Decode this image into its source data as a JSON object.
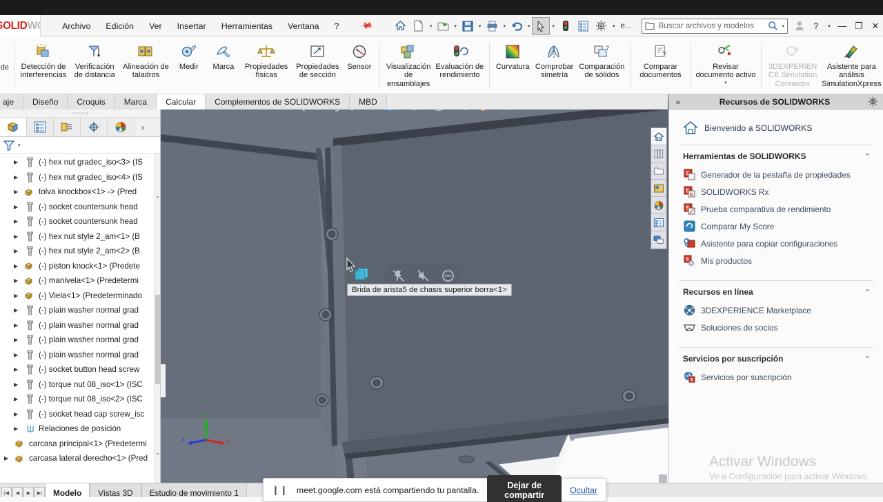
{
  "app": {
    "brand_solid": "SOLID",
    "brand_works": "WORKS"
  },
  "menubar": {
    "items": [
      {
        "label": "Archivo"
      },
      {
        "label": "Edición"
      },
      {
        "label": "Ver"
      },
      {
        "label": "Insertar"
      },
      {
        "label": "Herramientas"
      },
      {
        "label": "Ventana"
      },
      {
        "label": "?"
      }
    ],
    "pin_icon": "pin-icon"
  },
  "quick_access": {
    "buttons": [
      {
        "name": "home-icon",
        "caret": false
      },
      {
        "name": "new-document-icon",
        "caret": true
      },
      {
        "name": "open-folder-icon",
        "caret": true
      },
      {
        "name": "save-icon",
        "caret": true
      },
      {
        "name": "print-icon",
        "caret": true
      },
      {
        "name": "undo-icon",
        "caret": true
      },
      {
        "name": "select-arrow-icon",
        "caret": true
      },
      {
        "name": "rebuild-traffic-light-icon",
        "caret": false
      },
      {
        "name": "display-list-icon",
        "caret": false
      },
      {
        "name": "options-gear-icon",
        "caret": true
      }
    ],
    "overflow_label": "e..."
  },
  "search": {
    "placeholder": "Buscar archivos y modelos",
    "value": ""
  },
  "window_controls": {
    "account": "user-icon",
    "help": "?",
    "help_caret": "▾",
    "minimize": "—",
    "restore": "❐",
    "close": "✕"
  },
  "ribbon": {
    "left_stub": "de",
    "buttons": [
      {
        "label": "Detección de interferencias",
        "icon": "interference-detection-icon",
        "dim": false,
        "caret": false
      },
      {
        "label": "Verificación de distancia",
        "icon": "clearance-verification-icon",
        "dim": false,
        "caret": false
      },
      {
        "label": "Alineación de taladros",
        "icon": "hole-alignment-icon",
        "dim": false,
        "caret": false
      },
      {
        "label": "Medir",
        "icon": "measure-icon",
        "dim": false,
        "caret": false
      },
      {
        "label": "Marca",
        "icon": "markup-pen-icon",
        "dim": false,
        "caret": false
      },
      {
        "label": "Propiedades físicas",
        "icon": "mass-properties-icon",
        "dim": false,
        "caret": false
      },
      {
        "label": "Propiedades de sección",
        "icon": "section-properties-icon",
        "dim": false,
        "caret": false
      },
      {
        "label": "Sensor",
        "icon": "sensor-gauge-icon",
        "dim": false,
        "caret": false
      },
      {
        "label": "Visualización de ensamblajes",
        "icon": "assembly-visualization-icon",
        "dim": false,
        "caret": false
      },
      {
        "label": "Evaluación de rendimiento",
        "icon": "performance-evaluation-icon",
        "dim": false,
        "caret": false
      },
      {
        "label": "Curvatura",
        "icon": "curvature-icon",
        "dim": false,
        "caret": false
      },
      {
        "label": "Comprobar simetría",
        "icon": "symmetry-check-icon",
        "dim": false,
        "caret": false
      },
      {
        "label": "Comparación de sólidos",
        "icon": "solid-comparison-icon",
        "dim": false,
        "caret": false
      },
      {
        "label": "Comparar documentos",
        "icon": "compare-documents-icon",
        "dim": false,
        "caret": false
      },
      {
        "label": "Revisar documento activo",
        "icon": "check-active-document-icon",
        "dim": false,
        "caret": true
      },
      {
        "label": "3DEXPERIENCE Simulation Connector",
        "icon": "3dexperience-simulation-connector-icon",
        "dim": true,
        "caret": false
      },
      {
        "label": "Asistente para análisis SimulationXpress",
        "icon": "simulationxpress-wizard-icon",
        "dim": false,
        "caret": false
      }
    ],
    "separator_after": [
      7,
      9,
      12,
      13,
      14,
      15
    ]
  },
  "command_tabs": {
    "items": [
      {
        "label": "aje",
        "active": false
      },
      {
        "label": "Diseño",
        "active": false
      },
      {
        "label": "Croquis",
        "active": false
      },
      {
        "label": "Marca",
        "active": false
      },
      {
        "label": "Calcular",
        "active": true
      },
      {
        "label": "Complementos de SOLIDWORKS",
        "active": false
      },
      {
        "label": "MBD",
        "active": false
      }
    ]
  },
  "left_panel": {
    "tabs": [
      {
        "name": "feature-manager-tab",
        "icon": "feature-tree-cube-icon",
        "active": true
      },
      {
        "name": "property-manager-tab",
        "icon": "property-list-icon",
        "active": false
      },
      {
        "name": "configuration-manager-tab",
        "icon": "configuration-icon",
        "active": false
      },
      {
        "name": "dimxpert-manager-tab",
        "icon": "dimxpert-target-icon",
        "active": false
      },
      {
        "name": "display-manager-tab",
        "icon": "display-palette-icon",
        "active": false
      }
    ],
    "more_tabs": "›",
    "filter_icon": "filter-funnel-icon",
    "filter_caret": "▾",
    "tree_items": [
      {
        "label": "(-) hex nut gradec_iso<3> (IS",
        "icon": "fastener-icon",
        "expandable": true,
        "indent": 1
      },
      {
        "label": "(-) hex nut gradec_iso<4> (IS",
        "icon": "fastener-icon",
        "expandable": true,
        "indent": 1
      },
      {
        "label": "tolva knockbox<1> -> (Pred",
        "icon": "part-icon",
        "expandable": true,
        "indent": 1
      },
      {
        "label": "(-) socket countersunk head",
        "icon": "fastener-icon",
        "expandable": true,
        "indent": 1
      },
      {
        "label": "(-) socket countersunk head",
        "icon": "fastener-icon",
        "expandable": true,
        "indent": 1
      },
      {
        "label": "(-) hex nut style 2_am<1> (B",
        "icon": "fastener-icon",
        "expandable": true,
        "indent": 1
      },
      {
        "label": "(-) hex nut style 2_am<2> (B",
        "icon": "fastener-icon",
        "expandable": true,
        "indent": 1
      },
      {
        "label": "(-) piston knock<1> (Predete",
        "icon": "part-icon",
        "expandable": true,
        "indent": 1
      },
      {
        "label": "(-) manivela<1> (Predetermi",
        "icon": "part-icon",
        "expandable": true,
        "indent": 1
      },
      {
        "label": "(-) Viela<1> (Predeterminado",
        "icon": "part-icon",
        "expandable": true,
        "indent": 1
      },
      {
        "label": "(-) plain washer normal grad",
        "icon": "fastener-icon",
        "expandable": true,
        "indent": 1
      },
      {
        "label": "(-) plain washer normal grad",
        "icon": "fastener-icon",
        "expandable": true,
        "indent": 1
      },
      {
        "label": "(-) plain washer normal grad",
        "icon": "fastener-icon",
        "expandable": true,
        "indent": 1
      },
      {
        "label": "(-) plain washer normal grad",
        "icon": "fastener-icon",
        "expandable": true,
        "indent": 1
      },
      {
        "label": "(-) socket button head screw",
        "icon": "fastener-icon",
        "expandable": true,
        "indent": 1
      },
      {
        "label": "(-) torque nut 08_iso<1> (ISC",
        "icon": "fastener-icon",
        "expandable": true,
        "indent": 1
      },
      {
        "label": "(-) torque nut 08_iso<2> (ISC",
        "icon": "fastener-icon",
        "expandable": true,
        "indent": 1
      },
      {
        "label": "(-) socket head cap screw_isc",
        "icon": "fastener-icon",
        "expandable": true,
        "indent": 1
      },
      {
        "label": "Relaciones de posición",
        "icon": "mates-paperclip-icon",
        "expandable": true,
        "indent": 1
      },
      {
        "label": "carcasa principal<1> (Predetermi",
        "icon": "part-icon",
        "expandable": false,
        "indent": 0
      },
      {
        "label": "carcasa lateral derecho<1> (Pred",
        "icon": "part-icon",
        "expandable": true,
        "indent": 0
      }
    ],
    "scroll_up": "⌃",
    "scroll_down": "⌄"
  },
  "viewport": {
    "toolbar_buttons": [
      {
        "name": "zoom-to-area-icon",
        "caret": false
      },
      {
        "name": "zoom-to-fit-icon",
        "caret": false
      },
      {
        "name": "rotate-view-icon",
        "caret": false
      },
      {
        "name": "section-view-icon",
        "caret": false
      },
      {
        "name": "view-orientation-icon",
        "caret": false
      },
      {
        "name": "display-style-icon",
        "caret": true
      },
      {
        "name": "hide-show-items-icon",
        "caret": true
      },
      {
        "name": "apply-scene-icon",
        "caret": true
      },
      {
        "name": "view-settings-icon",
        "caret": false
      },
      {
        "name": "appearance-icon",
        "caret": false
      },
      {
        "name": "viewport-split-icon",
        "caret": false
      }
    ],
    "window_controls": [
      "◱",
      "◲",
      "—",
      "❐",
      "✕"
    ],
    "right_toolbar": [
      {
        "name": "swhome-icon",
        "active": true
      },
      {
        "name": "appearances-library-icon",
        "active": false
      },
      {
        "name": "design-library-folder-icon",
        "active": false
      },
      {
        "name": "file-explorer-icon",
        "active": false
      },
      {
        "name": "view-palette-icon",
        "active": false
      },
      {
        "name": "custom-properties-icon",
        "active": false
      },
      {
        "name": "solidworks-forum-icon",
        "active": false
      }
    ],
    "tooltip": "Brida de arista5 de chasis superior borra<1>",
    "mini_toolbar": [
      {
        "name": "unpin-icon"
      },
      {
        "name": "hide-component-icon"
      },
      {
        "name": "suppress-icon"
      }
    ],
    "triad": {
      "x": "x",
      "y": "y",
      "z": "z"
    }
  },
  "task_pane": {
    "collapse_icon": "«",
    "title": "Recursos de SOLIDWORKS",
    "gear_icon": "gear-icon",
    "welcome": {
      "label": "Bienvenido a SOLIDWORKS",
      "icon": "home-house-icon"
    },
    "sections": [
      {
        "title": "Herramientas de SOLIDWORKS",
        "chevron": "⌃",
        "items": [
          {
            "label": "Generador de la pestaña de propiedades",
            "icon": "property-tab-builder-icon"
          },
          {
            "label": "SOLIDWORKS Rx",
            "icon": "solidworks-rx-icon"
          },
          {
            "label": "Prueba comparativa de rendimiento",
            "icon": "performance-benchmark-icon"
          },
          {
            "label": "Comparar My Score",
            "icon": "compare-my-score-icon"
          },
          {
            "label": "Asistente para copiar configuraciones",
            "icon": "copy-settings-wizard-icon"
          },
          {
            "label": "Mis productos",
            "icon": "my-products-icon"
          }
        ]
      },
      {
        "title": "Recursos en línea",
        "chevron": "⌃",
        "items": [
          {
            "label": "3DEXPERIENCE Marketplace",
            "icon": "3dexperience-marketplace-icon"
          },
          {
            "label": "Soluciones de socios",
            "icon": "partner-solutions-icon"
          }
        ]
      },
      {
        "title": "Servicios por suscripción",
        "chevron": "⌃",
        "items": [
          {
            "label": "Servicios por suscripción",
            "icon": "subscription-services-icon"
          }
        ]
      }
    ]
  },
  "watermark": {
    "line1": "Activar Windows",
    "line2": "Ve a Configuración para activar Windows."
  },
  "status_bar": {
    "nav_buttons": [
      "|◀",
      "◀",
      "▶",
      "▶|"
    ],
    "tabs": [
      {
        "label": "Modelo",
        "active": true
      },
      {
        "label": "Vistas 3D",
        "active": false
      },
      {
        "label": "Estudio de movimiento 1",
        "active": false
      }
    ]
  },
  "share_bar": {
    "pause_icon": "pause-icon",
    "message": "meet.google.com está compartiendo tu pantalla.",
    "stop_label": "Dejar de compartir",
    "hide_label": "Ocultar"
  },
  "colors": {
    "accent_red": "#d32b1e",
    "viewport_bg": "#6d7482",
    "model_face": "#5f6775",
    "tab_active": "#ffffff",
    "share_button": "#313131",
    "link_blue": "#1d4fa8"
  }
}
